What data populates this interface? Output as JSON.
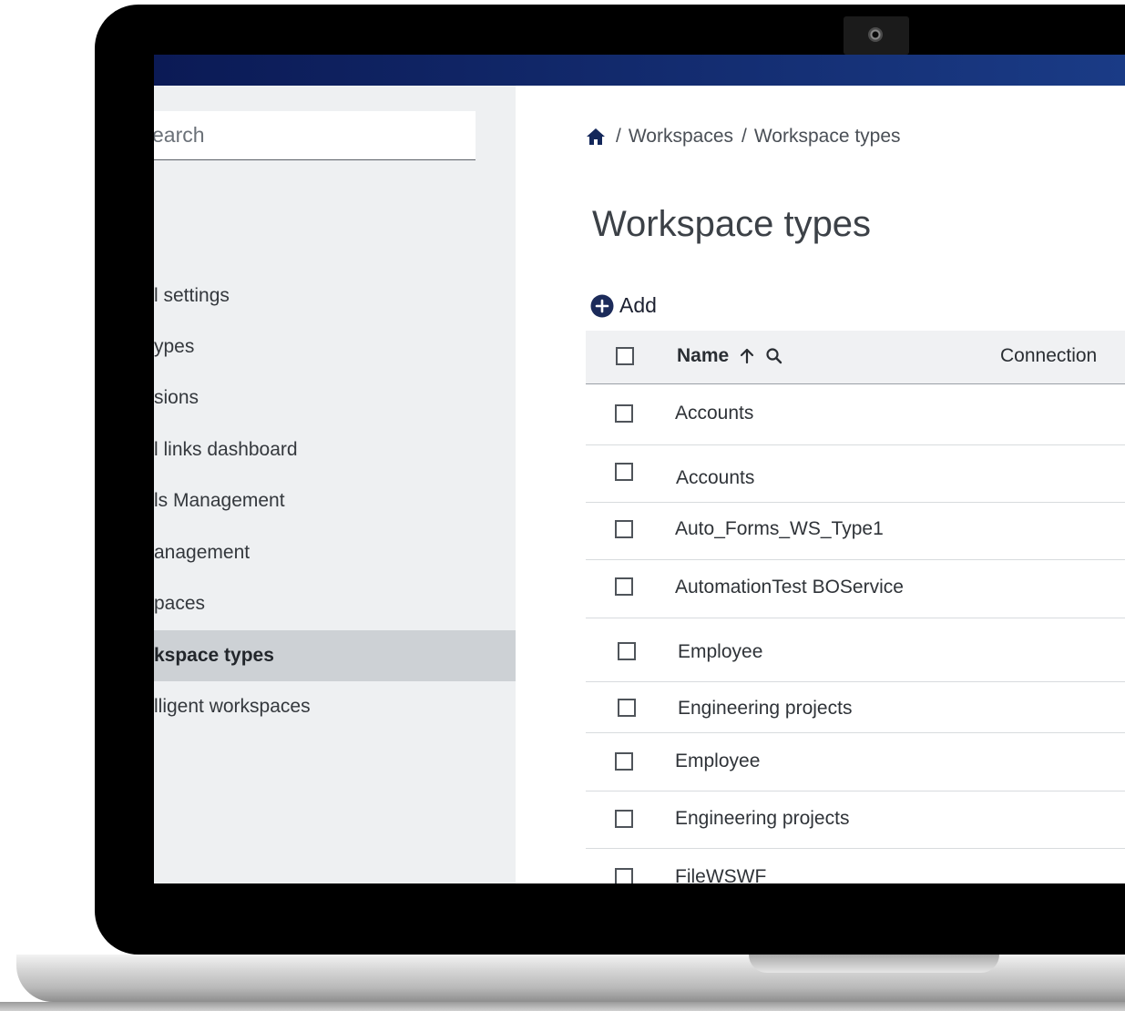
{
  "search": {
    "placeholder": "earch"
  },
  "sidebar": {
    "items": [
      {
        "label": "l settings"
      },
      {
        "label": "ypes"
      },
      {
        "label": "sions"
      },
      {
        "label": "l links dashboard"
      },
      {
        "label": "ls Management"
      },
      {
        "label": "anagement"
      },
      {
        "label": "paces"
      },
      {
        "label": "kspace types"
      },
      {
        "label": "lligent workspaces"
      }
    ]
  },
  "breadcrumb": {
    "items": [
      "Workspaces",
      "Workspace types"
    ],
    "separator": "/"
  },
  "page": {
    "title": "Workspace types"
  },
  "toolbar": {
    "add_label": "Add"
  },
  "table": {
    "columns": {
      "name": "Name",
      "connection": "Connection"
    },
    "sort": "ascending",
    "rows": [
      {
        "name": "Accounts"
      },
      {
        "name": "Accounts"
      },
      {
        "name": "Auto_Forms_WS_Type1"
      },
      {
        "name": "AutomationTest BOService"
      },
      {
        "name": "Employee"
      },
      {
        "name": "Engineering projects"
      },
      {
        "name": "Employee"
      },
      {
        "name": "Engineering projects"
      },
      {
        "name": "FileWSWF"
      }
    ]
  },
  "colors": {
    "topbar": "#0b1a55",
    "accent": "#1c2b5a",
    "sidebar_bg": "#eef0f2",
    "active_bg": "#cdd1d5"
  },
  "icons": [
    "home-icon",
    "add-icon",
    "sort-up-icon",
    "search-icon",
    "camera-icon"
  ]
}
